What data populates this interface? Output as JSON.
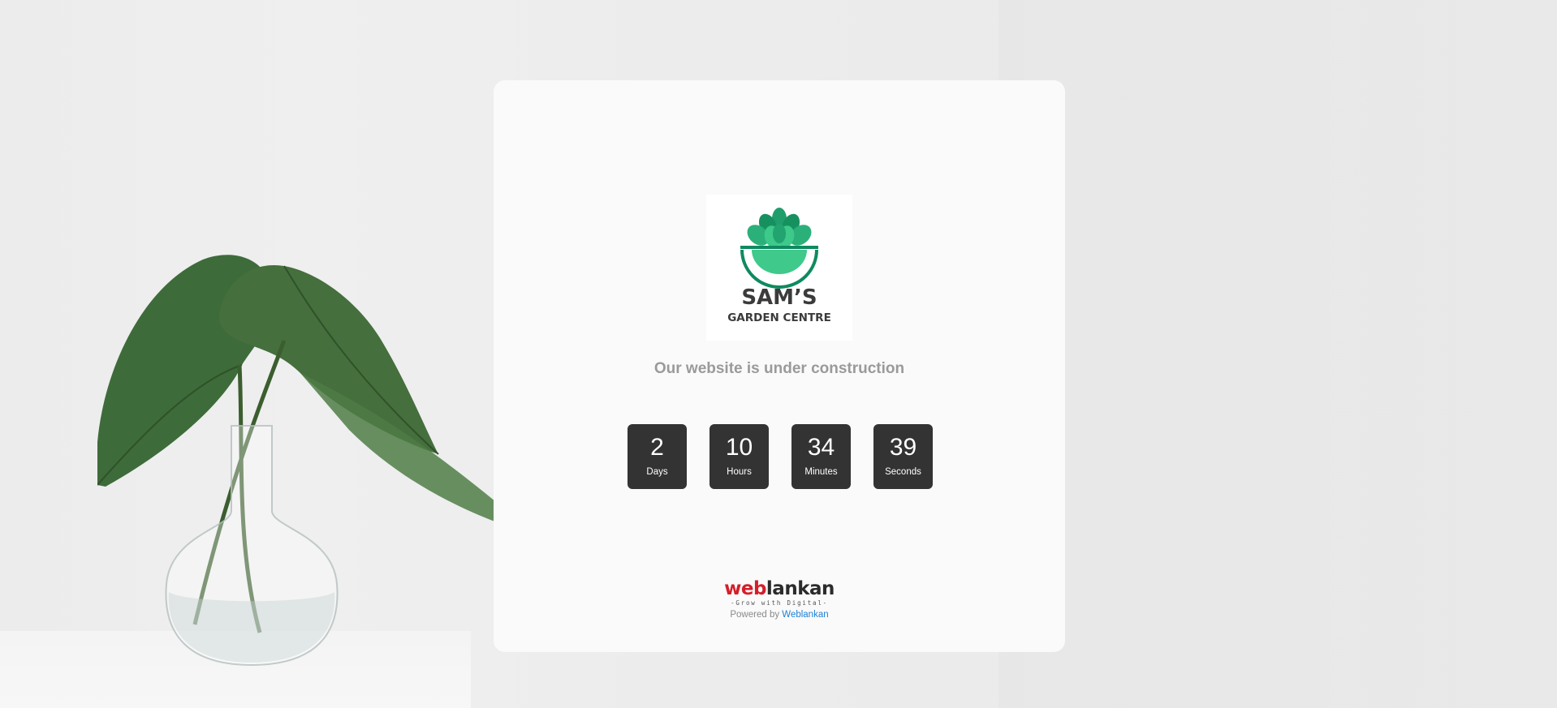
{
  "background": {
    "scene": "plant-in-glass-vase"
  },
  "card": {
    "logo": {
      "line1": "SAM’S",
      "line2": "GARDEN CENTRE",
      "colors": {
        "leaf_dark": "#0f8a5f",
        "leaf_light": "#3fc98a",
        "text": "#3b3b3b"
      }
    },
    "headline": "Our website is under construction",
    "countdown": [
      {
        "value": "2",
        "label": "Days"
      },
      {
        "value": "10",
        "label": "Hours"
      },
      {
        "value": "34",
        "label": "Minutes"
      },
      {
        "value": "39",
        "label": "Seconds"
      }
    ],
    "footer": {
      "brand_part1": "web",
      "brand_part2": "lankan",
      "tagline": "-Grow with Digital-",
      "powered_prefix": "Powered by",
      "powered_link": "Weblankan",
      "link_color": "#1e7fd6",
      "brand_red": "#d41f2a"
    }
  }
}
